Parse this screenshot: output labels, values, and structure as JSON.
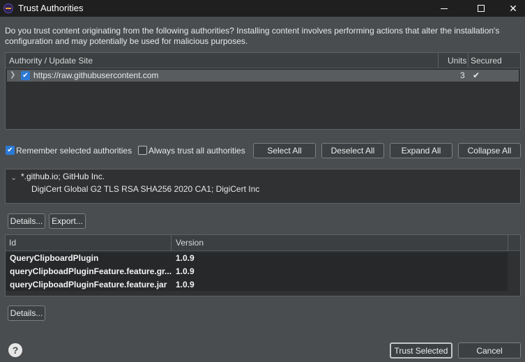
{
  "window": {
    "title": "Trust Authorities",
    "minimize": "—",
    "maximize": "□",
    "close": "✕"
  },
  "intro_text": "Do you trust content originating from the following authorities?  Installing content involves performing actions that alter the installation's configuration and may potentially be used for malicious purposes.",
  "authority_table": {
    "columns": [
      "Authority / Update Site",
      "Units",
      "Secured"
    ],
    "rows": [
      {
        "site": "https://raw.githubusercontent.com",
        "units": "3",
        "secured": "✔",
        "checked": true
      }
    ]
  },
  "options": {
    "remember_label": "Remember selected authorities",
    "always_trust_label": "Always trust all authorities",
    "remember_checked": true,
    "always_trust_checked": false
  },
  "buttons": {
    "select_all": "Select All",
    "deselect_all": "Deselect All",
    "expand_all": "Expand All",
    "collapse_all": "Collapse All",
    "details": "Details...",
    "export": "Export...",
    "details2": "Details...",
    "trust_selected": "Trust Selected",
    "cancel": "Cancel"
  },
  "certificate_tree": {
    "root": "*.github.io; GitHub Inc.",
    "child": "DigiCert Global G2 TLS RSA SHA256 2020 CA1; DigiCert Inc"
  },
  "units_table": {
    "columns": [
      "Id",
      "Version"
    ],
    "rows": [
      {
        "id": "QueryClipboardPlugin",
        "version": "1.0.9"
      },
      {
        "id": "queryClipboadPluginFeature.feature.gr...",
        "version": "1.0.9"
      },
      {
        "id": "queryClipboadPluginFeature.feature.jar",
        "version": "1.0.9"
      }
    ]
  },
  "colors": {
    "background": "#4a4d50",
    "titlebar": "#1f1f1f",
    "panel": "#2f3133",
    "accent_checkbox": "#2d7ad6"
  },
  "icons": [
    "app-icon",
    "chevron-right-icon",
    "chevron-down-icon",
    "checkmark-icon",
    "help-icon"
  ]
}
